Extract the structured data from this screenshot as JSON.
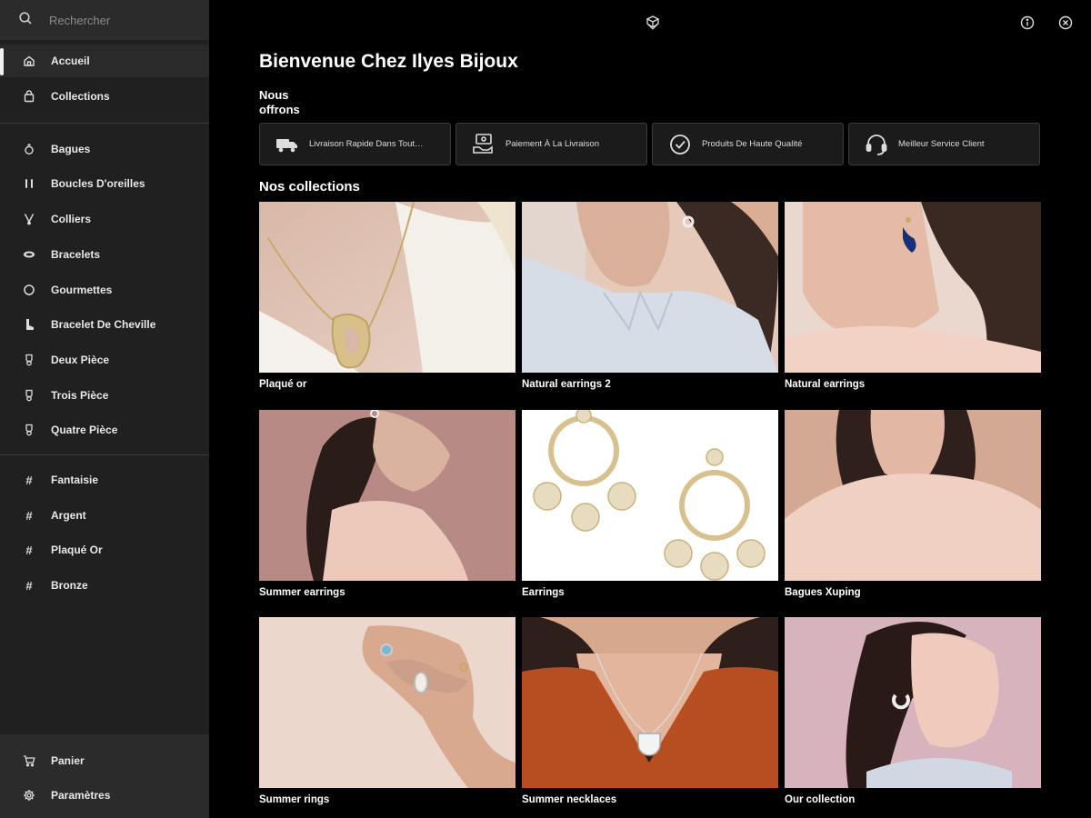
{
  "search": {
    "placeholder": "Rechercher"
  },
  "sidebar": {
    "primary": [
      {
        "label": "Accueil",
        "icon": "home-icon",
        "active": true
      },
      {
        "label": "Collections",
        "icon": "bag-icon"
      }
    ],
    "categories": [
      {
        "label": "Bagues",
        "icon": "ring-icon"
      },
      {
        "label": "Boucles D'oreilles",
        "icon": "earrings-icon"
      },
      {
        "label": "Colliers",
        "icon": "necklace-icon"
      },
      {
        "label": "Bracelets",
        "icon": "bracelet-icon"
      },
      {
        "label": "Gourmettes",
        "icon": "gourmette-icon"
      },
      {
        "label": "Bracelet De Cheville",
        "icon": "ankle-icon"
      },
      {
        "label": "Deux Pièce",
        "icon": "set-icon"
      },
      {
        "label": "Trois Pièce",
        "icon": "set-icon"
      },
      {
        "label": "Quatre Pièce",
        "icon": "set-icon"
      }
    ],
    "tags": [
      {
        "label": "Fantaisie",
        "icon": "hash-icon"
      },
      {
        "label": "Argent",
        "icon": "hash-icon"
      },
      {
        "label": "Plaqué Or",
        "icon": "hash-icon"
      },
      {
        "label": "Bronze",
        "icon": "hash-icon"
      }
    ],
    "bottom": [
      {
        "label": "Panier",
        "icon": "cart-icon"
      },
      {
        "label": "Paramètres",
        "icon": "gear-icon"
      }
    ]
  },
  "main": {
    "title": "Bienvenue Chez Ilyes Bijoux",
    "offers_title": "Nous offrons",
    "offers": [
      {
        "label": "Livraison Rapide Dans Tout…",
        "icon": "truck-icon"
      },
      {
        "label": "Paiement À La Livraison",
        "icon": "cash-icon"
      },
      {
        "label": "Produits De Haute Qualité",
        "icon": "check-circle-icon"
      },
      {
        "label": "Meilleur Service Client",
        "icon": "headset-icon"
      }
    ],
    "collections_title": "Nos collections",
    "collections": [
      {
        "label": "Plaqué or"
      },
      {
        "label": "Natural earrings 2"
      },
      {
        "label": "Natural earrings"
      },
      {
        "label": "Summer earrings"
      },
      {
        "label": "Earrings"
      },
      {
        "label": "Bagues Xuping"
      },
      {
        "label": "Summer rings"
      },
      {
        "label": "Summer necklaces"
      },
      {
        "label": "Our collection"
      }
    ]
  },
  "colors": {
    "background": "#000000",
    "sidebar": "#202020",
    "card_border": "#3a3a3a"
  }
}
